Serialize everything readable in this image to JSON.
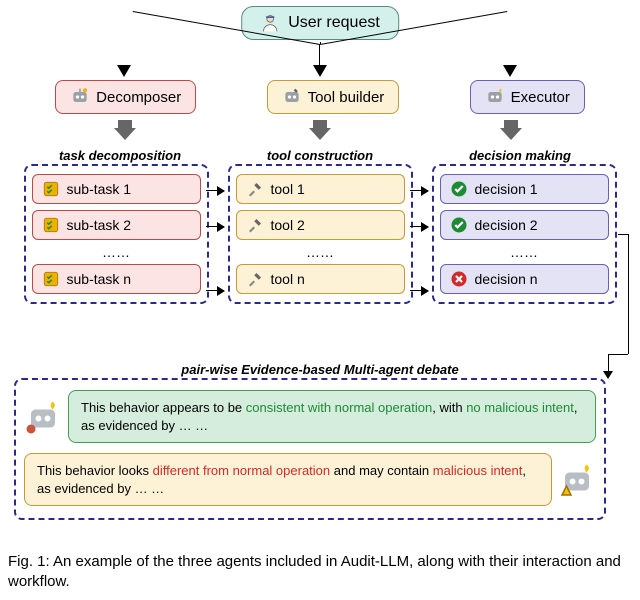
{
  "user_request": "User request",
  "agents": {
    "decomposer": "Decomposer",
    "toolbuilder": "Tool builder",
    "executor": "Executor"
  },
  "column_labels": {
    "task_decomposition": "task decomposition",
    "tool_construction": "tool construction",
    "decision_making": "decision making"
  },
  "subtasks": [
    "sub-task 1",
    "sub-task 2",
    "sub-task n"
  ],
  "tools": [
    "tool 1",
    "tool 2",
    "tool n"
  ],
  "decisions": [
    "decision 1",
    "decision 2",
    "decision n"
  ],
  "ellipsis": "……",
  "debate_label": "pair-wise Evidence-based Multi-agent debate",
  "speech_safe": {
    "pre": "This behavior appears to be ",
    "g1": "consistent with normal operation",
    "mid": ", with ",
    "g2": "no malicious intent",
    "post": ", as evidenced by … …"
  },
  "speech_warn": {
    "pre": "This behavior looks ",
    "r1": "different from normal operation",
    "mid": " and may contain ",
    "r2": "malicious intent",
    "post": ", as evidenced by … …"
  },
  "caption_prefix": "Fig. 1: ",
  "caption_body": "An example of the three agents included in Audit-LLM, along with their interaction and workflow."
}
